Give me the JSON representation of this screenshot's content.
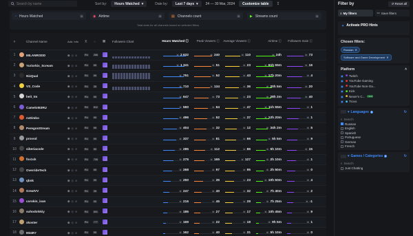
{
  "topbar": {
    "search_placeholder": "Search by name",
    "sort_label": "Sort by:",
    "sort_value": "Hours Watched",
    "date_label": "Date by:",
    "date_value": "Last 7 days",
    "date_range": "24 — 30 Mar, 2024",
    "customize_label": "Customize table"
  },
  "cards": {
    "items": [
      "Hours Watched",
      "Airtime",
      "Channels count",
      "Streams count"
    ],
    "note": "Total stats for all channels based on selected filters"
  },
  "table": {
    "headers": {
      "num": "#",
      "name": "Channel Name",
      "add": "Add. Info",
      "followers_chart": "Followers Chart",
      "hours": "Hours Watched",
      "peak": "Peak Viewers",
      "avg": "Average Viewers",
      "airtime": "Airtime",
      "followers": "Followers Gain"
    },
    "rows": [
      {
        "num": "1",
        "name": "MILANRODD",
        "lang": "RU",
        "cnt": "288",
        "hours": "2 632",
        "peak": "240",
        "avg": "110",
        "airtime": "24h",
        "followers": "73",
        "color": "#e0a07a"
      },
      {
        "num": "2",
        "name": "Yuriorkis_Scream",
        "lang": "RU",
        "cnt": "5K",
        "hours": "1 341",
        "peak": "51",
        "avg": "23",
        "airtime": "61h 55m",
        "followers": "16",
        "color": "#c9a277"
      },
      {
        "num": "3",
        "name": "NizQual",
        "lang": "RU",
        "cnt": "5K",
        "hours": "751",
        "peak": "52",
        "avg": "43",
        "airtime": "17h 20m",
        "followers": "4",
        "color": "#2c2c2c"
      },
      {
        "num": "4",
        "name": "VS_Code",
        "lang": "RU",
        "cnt": "3K",
        "hours": "710",
        "peak": "134",
        "avg": "36",
        "airtime": "20h 5m",
        "followers": "20",
        "color": "#f0d040"
      },
      {
        "num": "5",
        "name": "heit_tm",
        "lang": "RU",
        "cnt": "5K",
        "hours": "647",
        "peak": "73",
        "avg": "23",
        "airtime": "28h 2m",
        "followers": "40",
        "color": "#d6d6d6"
      },
      {
        "num": "6",
        "name": "Camelot63RU",
        "lang": "RU",
        "cnt": "812",
        "hours": "560",
        "peak": "64",
        "avg": "47",
        "airtime": "11h 55m",
        "followers": "1",
        "color": "#7b5cd6"
      },
      {
        "num": "7",
        "name": "ruDimbo",
        "lang": "RU",
        "cnt": "5K",
        "hours": "496",
        "peak": "52",
        "avg": "37",
        "airtime": "12h 20m",
        "followers": "1",
        "color": "#e05a2f"
      },
      {
        "num": "8",
        "name": "PeregonStream",
        "lang": "RU",
        "cnt": "5K",
        "hours": "404",
        "peak": "32",
        "avg": "12",
        "airtime": "34h 2m",
        "followers": "5",
        "color": "#b08a6a"
      },
      {
        "num": "9",
        "name": "provod",
        "lang": "RU",
        "cnt": "5K",
        "hours": "337",
        "peak": "81",
        "avg": "66",
        "airtime": "5h 5m",
        "followers": "9",
        "color": "#9a9a9a"
      },
      {
        "num": "10",
        "name": "siberiacode",
        "lang": "RU",
        "cnt": "5K",
        "hours": "285",
        "peak": "112",
        "avg": "86",
        "airtime": "5h 10m",
        "followers": "15",
        "color": "#444"
      },
      {
        "num": "11",
        "name": "fox1ck",
        "lang": "RU",
        "cnt": "708",
        "hours": "275",
        "peak": "165",
        "avg": "127",
        "airtime": "2h 10m",
        "followers": "1",
        "color": "#d07030"
      },
      {
        "num": "12",
        "name": "OverrideTech",
        "lang": "RU",
        "cnt": "5K",
        "hours": "268",
        "peak": "97",
        "avg": "95",
        "airtime": "2h 50m",
        "followers": "0",
        "color": "#444"
      },
      {
        "num": "13",
        "name": "qbnk",
        "lang": "RU",
        "cnt": "5K",
        "hours": "250",
        "peak": "35",
        "avg": "23",
        "airtime": "10h 50m",
        "followers": "4",
        "color": "#7090c0"
      },
      {
        "num": "14",
        "name": "GreatVV",
        "lang": "RU",
        "cnt": "3K",
        "hours": "247",
        "peak": "40",
        "avg": "32",
        "airtime": "7h 40m",
        "followers": "2",
        "color": "#b07a5a"
      },
      {
        "num": "15",
        "name": "corokin_ivan",
        "lang": "RU",
        "cnt": "5K",
        "hours": "216",
        "peak": "45",
        "avg": "29",
        "airtime": "7h 25m",
        "followers": "-1",
        "color": "#9a4fd0"
      },
      {
        "num": "16",
        "name": "suhodolskiy",
        "lang": "RU",
        "cnt": "801",
        "hours": "186",
        "peak": "27",
        "avg": "17",
        "airtime": "10h 45m",
        "followers": "9",
        "color": "#8a7a6a"
      },
      {
        "num": "17",
        "name": "xkoster",
        "lang": "RU",
        "cnt": "777",
        "hours": "169",
        "peak": "22",
        "avg": "18",
        "airtime": "9h 5m",
        "followers": "1",
        "color": "#c0a070"
      },
      {
        "num": "18",
        "name": "M34R7",
        "lang": "RU",
        "cnt": "5K",
        "hours": "162",
        "peak": "40",
        "avg": "31",
        "airtime": "5h 10m",
        "followers": "0",
        "color": "#6b6b6b"
      }
    ]
  },
  "panel": {
    "title": "Filter by",
    "reset_label": "Reset all",
    "tab_my": "My filters",
    "tab_save": "Save filters",
    "pro_label": "Activate PRO Hints",
    "chosen_title": "Chosen filters:",
    "chips": [
      "Russian",
      "Software and Game Development"
    ],
    "platform_title": "Platform",
    "platforms": [
      {
        "name": "Twitch",
        "new": ""
      },
      {
        "name": "YouTube Gaming",
        "new": ""
      },
      {
        "name": "YouTube Non-Ga...",
        "new": ""
      },
      {
        "name": "Kick",
        "new": ""
      },
      {
        "name": "Nexer's C...",
        "new": "NEW"
      },
      {
        "name": "Trovo",
        "new": ""
      }
    ],
    "languages_title": "Languages",
    "languages_count": "1",
    "search_placeholder": "Search",
    "languages": [
      "Russian",
      "English",
      "Spanish",
      "Portuguese",
      "German",
      "French"
    ],
    "games_title": "Games / Categories",
    "games_count": "1",
    "games": [
      "Just Chatting"
    ]
  },
  "colors": {
    "accent": "#3d8bfd",
    "twitch": "#9146ff",
    "youtube": "#ff3d3d",
    "kick": "#53fc18"
  }
}
